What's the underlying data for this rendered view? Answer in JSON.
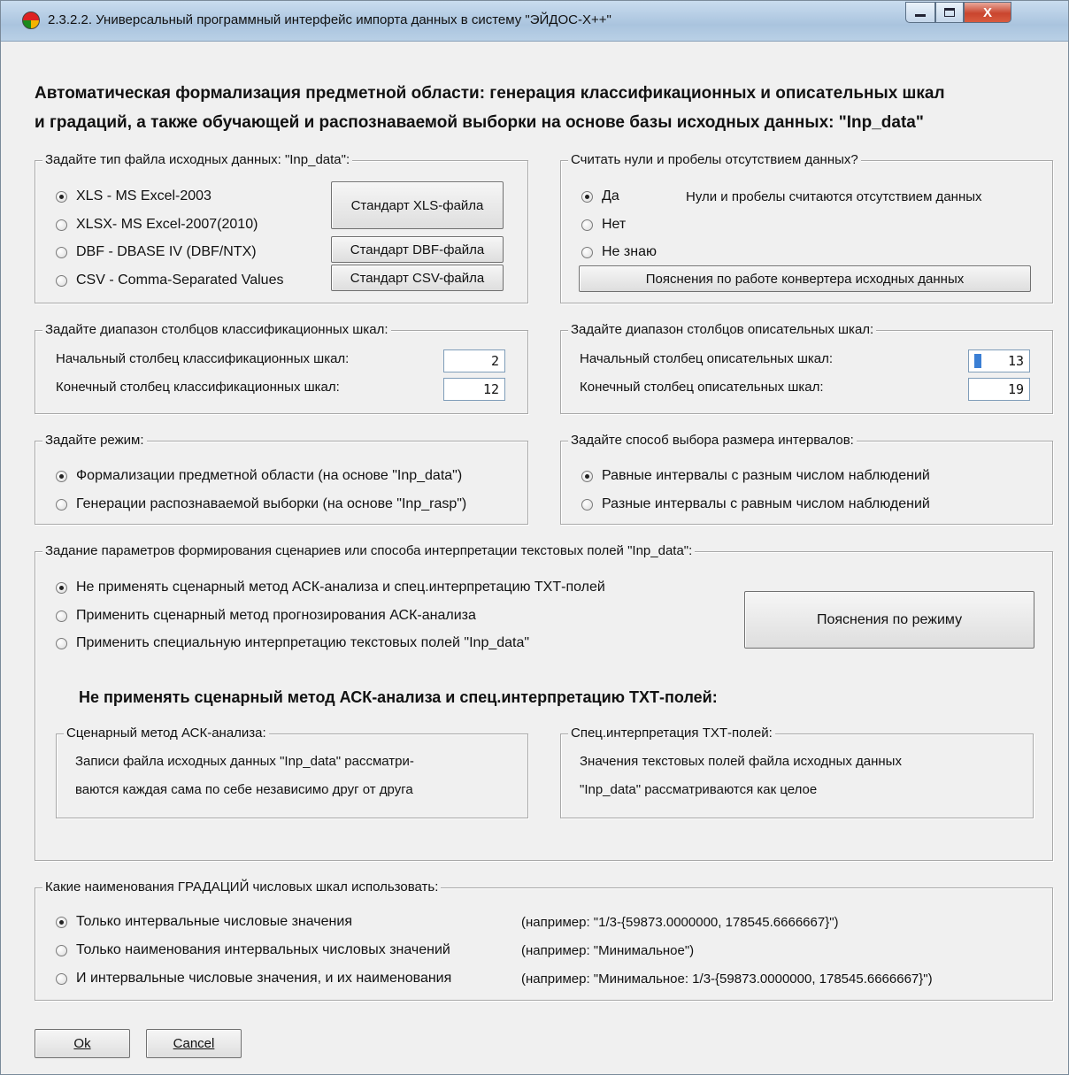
{
  "window": {
    "title": "2.3.2.2. Универсальный программный интерфейс импорта данных в систему \"ЭЙДОС-Х++\"",
    "close_glyph": "X"
  },
  "heading": {
    "line1": "Автоматическая формализация предметной области: генерация классификационных и описательных шкал",
    "line2": "и градаций,  а также обучающей и распознаваемой выборки  на  основе  базы исходных данных: \"Inp_data\""
  },
  "file_type": {
    "title": "Задайте тип файла исходных данных: \"Inp_data\":",
    "options": [
      {
        "label": "XLS  - MS Excel-2003",
        "selected": true
      },
      {
        "label": "XLSX- MS Excel-2007(2010)",
        "selected": false
      },
      {
        "label": "DBF  - DBASE IV (DBF/NTX)",
        "selected": false
      },
      {
        "label": "CSV  - Comma-Separated Values",
        "selected": false
      }
    ],
    "btn_xls": "Стандарт XLS-файла",
    "btn_dbf": "Стандарт DBF-файла",
    "btn_csv": "Стандарт CSV-файла"
  },
  "zeros": {
    "title": "Считать нули и пробелы отсутствием данных?",
    "options": [
      {
        "label": "Да",
        "selected": true
      },
      {
        "label": "Нет",
        "selected": false
      },
      {
        "label": "Не знаю",
        "selected": false
      }
    ],
    "note": "Нули и пробелы считаются отсутствием данных",
    "btn_help": "Пояснения по работе конвертера исходных данных"
  },
  "class_range": {
    "title": "Задайте диапазон столбцов классификационных шкал:",
    "start_label": "Начальный столбец классификационных шкал:",
    "end_label": "Конечный  столбец классификационных шкал:",
    "start_value": "2",
    "end_value": "12"
  },
  "desc_range": {
    "title": "Задайте диапазон столбцов описательных шкал:",
    "start_label": "Начальный столбец описательных шкал:",
    "end_label": "Конечный  столбец описательных шкал:",
    "start_value": "13",
    "end_value": "19"
  },
  "mode": {
    "title": "Задайте режим:",
    "options": [
      {
        "label": "Формализации предметной  области (на основе \"Inp_data\")",
        "selected": true
      },
      {
        "label": "Генерации распознаваемой выборки (на основе \"Inp_rasp\")",
        "selected": false
      }
    ]
  },
  "interval": {
    "title": "Задайте способ выбора размера интервалов:",
    "options": [
      {
        "label": "Равные интервалы с разным числом наблюдений",
        "selected": true
      },
      {
        "label": "Разные интервалы с равным числом наблюдений",
        "selected": false
      }
    ]
  },
  "scenario": {
    "title": "Задание параметров формирования сценариев или способа интерпретации текстовых полей \"Inp_data\":",
    "options": [
      {
        "label": "Не применять сценарный метод АСК-анализа и спец.интерпретацию ТХТ-полей",
        "selected": true
      },
      {
        "label": "Применить сценарный метод прогнозирования АСК-анализа",
        "selected": false
      },
      {
        "label": "Применить специальную интерпретацию текстовых полей \"Inp_data\"",
        "selected": false
      }
    ],
    "btn_help": "Пояснения по режиму",
    "subheading": "Не применять сценарный метод АСК-анализа и спец.интерпретацию ТХТ-полей:",
    "scen_title": "Сценарный метод АСК-анализа:",
    "scen_line1": "Записи файла исходных данных \"Inp_data\" рассматри-",
    "scen_line2": "ваются каждая сама по себе независимо друг от друга",
    "txt_title": "Спец.интерпретация ТХТ-полей:",
    "txt_line1": "Значения текстовых полей файла исходных данных",
    "txt_line2": "\"Inp_data\" рассматриваются как целое"
  },
  "gradations": {
    "title": "Какие наименования ГРАДАЦИЙ числовых шкал использовать:",
    "options": [
      {
        "label": "Только интервальные числовые значения",
        "example": "(например: \"1/3-{59873.0000000, 178545.6666667}\")",
        "selected": true
      },
      {
        "label": "Только наименования интервальных числовых значений",
        "example": "(например: \"Минимальное\")",
        "selected": false
      },
      {
        "label": "И интервальные числовые значения, и их наименования",
        "example": "(например: \"Минимальное: 1/3-{59873.0000000, 178545.6666667}\")",
        "selected": false
      }
    ]
  },
  "buttons": {
    "ok": "Ok",
    "cancel": "Cancel"
  }
}
